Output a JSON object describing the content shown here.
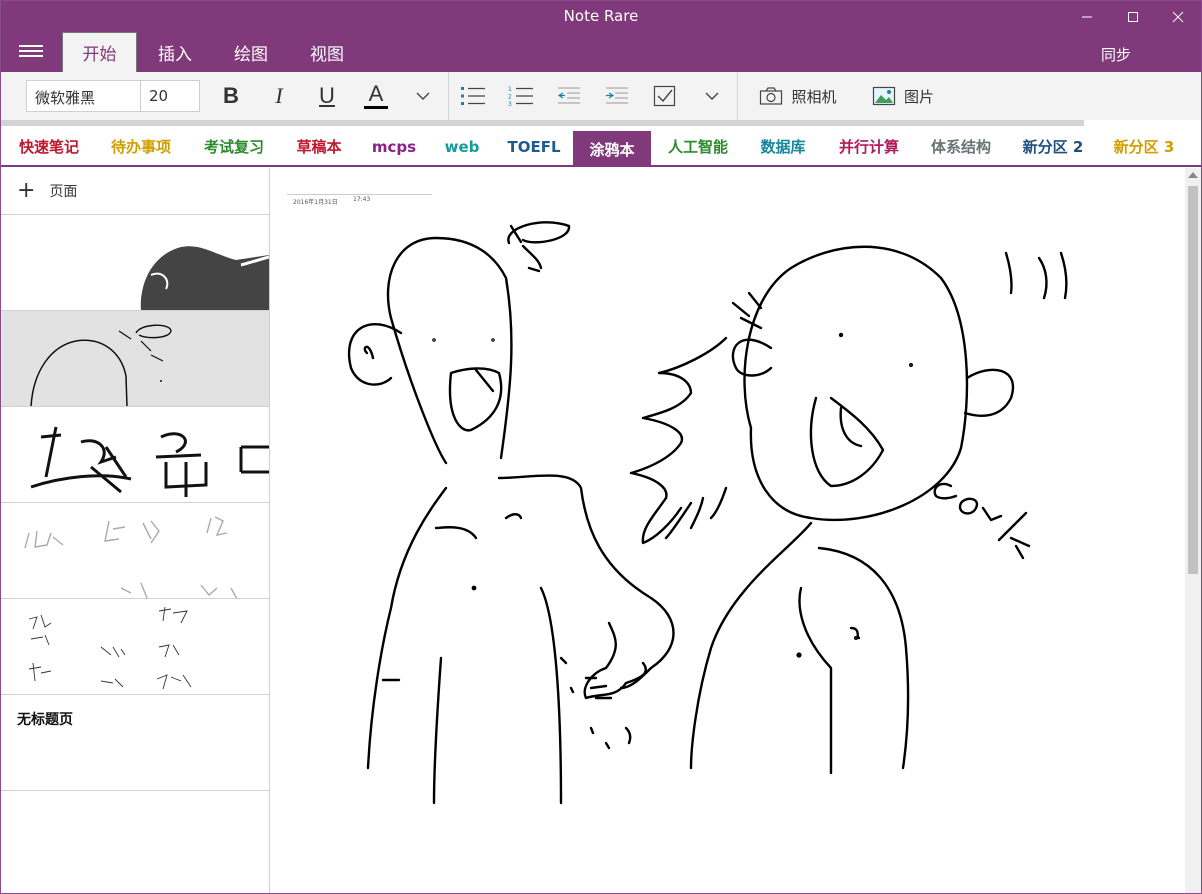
{
  "window": {
    "title": "Note Rare"
  },
  "ribbon": {
    "tabs": [
      "开始",
      "插入",
      "绘图",
      "视图"
    ],
    "active_tab": "开始",
    "sync_label": "同步"
  },
  "toolbar": {
    "font_name": "微软雅黑",
    "font_size": "20",
    "bold": "B",
    "italic": "I",
    "underline": "U",
    "font_color": "A",
    "camera_label": "照相机",
    "picture_label": "图片"
  },
  "sections": [
    {
      "label": "快速笔记",
      "color": "#c0172d"
    },
    {
      "label": "待办事项",
      "color": "#d19e00"
    },
    {
      "label": "考试复习",
      "color": "#2d8a2d"
    },
    {
      "label": "草稿本",
      "color": "#c0172d"
    },
    {
      "label": "mcps",
      "color": "#8b2286"
    },
    {
      "label": "web",
      "color": "#169a9a"
    },
    {
      "label": "TOEFL",
      "color": "#1f5b8e"
    },
    {
      "label": "涂鸦本",
      "color": "#ffffff"
    },
    {
      "label": "人工智能",
      "color": "#2d8a2d"
    },
    {
      "label": "数据库",
      "color": "#17869a"
    },
    {
      "label": "并行计算",
      "color": "#b01a5a"
    },
    {
      "label": "体系结构",
      "color": "#6a7475"
    },
    {
      "label": "新分区 2",
      "color": "#1f4f7e"
    },
    {
      "label": "新分区 3",
      "color": "#d19e00"
    }
  ],
  "active_section": "涂鸦本",
  "pages": {
    "add_label": "页面",
    "untitled_label": "无标题页"
  },
  "canvas": {
    "date": "2016年1月31日",
    "time": "17:43"
  },
  "colors": {
    "accent": "#80397b",
    "toolbar_bg": "#f3f3f3"
  }
}
